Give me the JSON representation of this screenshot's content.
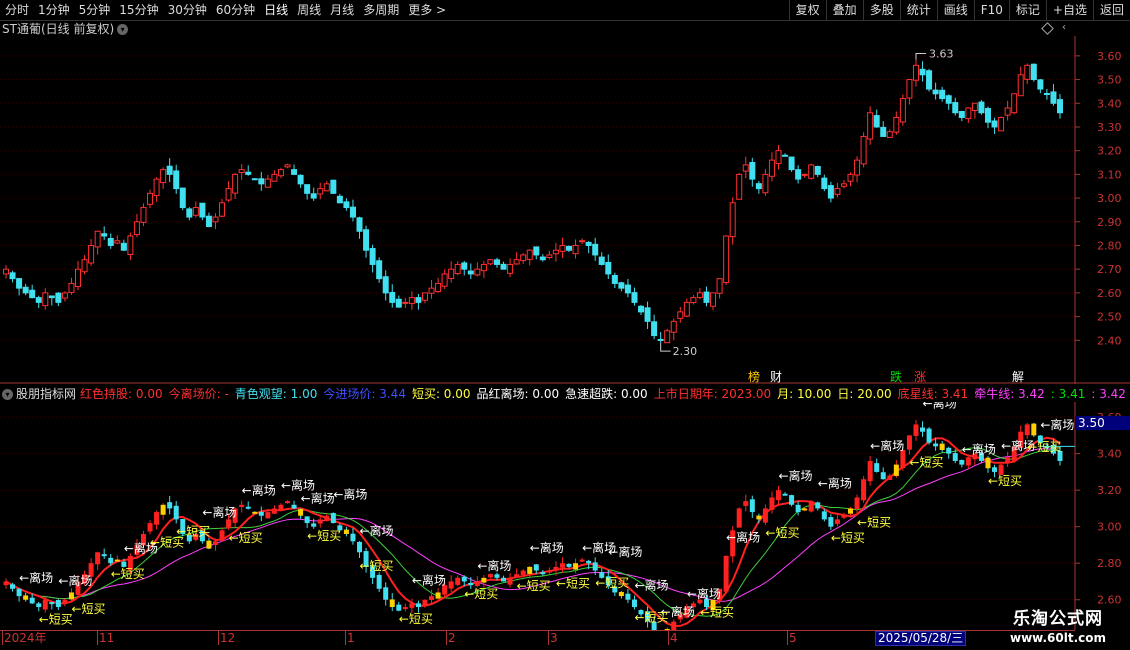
{
  "toolbar": {
    "left": [
      "分时",
      "1分钟",
      "5分钟",
      "15分钟",
      "30分钟",
      "60分钟",
      "日线",
      "周线",
      "月线",
      "多周期",
      "更多 >"
    ],
    "right": [
      "复权",
      "叠加",
      "多股",
      "统计",
      "画线",
      "F10",
      "标记",
      "+自选",
      "返回"
    ]
  },
  "main_panel": {
    "title": "ST通葡(日线 前复权)",
    "y_ticks": [
      "3.60",
      "3.50",
      "3.40",
      "3.30",
      "3.20",
      "3.10",
      "3.00",
      "2.90",
      "2.80",
      "2.70",
      "2.60",
      "2.50",
      "2.40"
    ],
    "high_label": "3.63",
    "low_label": "2.30",
    "event_tags": [
      {
        "text": "榜",
        "color": "#ffcc00"
      },
      {
        "text": "财",
        "color": "#ffffff"
      },
      {
        "text": "跌",
        "color": "#00e000"
      },
      {
        "text": "涨",
        "color": "#ff3030"
      },
      {
        "text": "解",
        "color": "#ffffff"
      }
    ]
  },
  "sub_panel": {
    "name": "股朋指标网",
    "fields": [
      {
        "text": "红色持股: 0.00",
        "color": "#ff3030"
      },
      {
        "text": "今离场价: -",
        "color": "#ff3030"
      },
      {
        "text": "青色观望: 1.00",
        "color": "#40e0f0"
      },
      {
        "text": "今进场价: 3.44",
        "color": "#4050ff"
      },
      {
        "text": "短买: 0.00",
        "color": "#ffff40"
      },
      {
        "text": "品红离场: 0.00",
        "color": "#ffffff"
      },
      {
        "text": "急速超跌: 0.00",
        "color": "#ffffff"
      },
      {
        "text": "上市日期年: 2023.00",
        "color": "#ff3030"
      },
      {
        "text": "月: 10.00",
        "color": "#ffff40"
      },
      {
        "text": "日: 20.00",
        "color": "#ffff40"
      },
      {
        "text": "底星线: 3.41",
        "color": "#ff3030"
      },
      {
        "text": "牵牛线: 3.42",
        "color": "#ff40ff"
      },
      {
        "text": ": 3.41",
        "color": "#00e000"
      },
      {
        "text": ": 3.42",
        "color": "#ff40ff"
      }
    ],
    "y_ticks": [
      "3.60",
      "3.40",
      "3.20",
      "3.00",
      "2.80",
      "2.60"
    ],
    "current_price": "3.50",
    "signal_exit": "←离场",
    "signal_buy": "←短买"
  },
  "x_axis": {
    "labels": [
      "2024年",
      "11",
      "12",
      "1",
      "2",
      "3",
      "4",
      "5"
    ],
    "current_date": "2025/05/28/三"
  },
  "watermark": {
    "line1": "乐淘公式网",
    "line2": "www.60lt.com"
  },
  "chart_data": {
    "type": "candlestick",
    "title": "ST通葡(日线 前复权)",
    "ylim": [
      2.3,
      3.65
    ],
    "period_labels": [
      "2024年",
      "11",
      "12",
      "1",
      "2",
      "3",
      "4",
      "5"
    ],
    "close": [
      2.7,
      2.66,
      2.62,
      2.6,
      2.58,
      2.56,
      2.6,
      2.58,
      2.56,
      2.6,
      2.64,
      2.7,
      2.74,
      2.8,
      2.86,
      2.84,
      2.8,
      2.82,
      2.78,
      2.84,
      2.9,
      2.96,
      3.02,
      3.08,
      3.12,
      3.1,
      3.04,
      2.96,
      2.92,
      2.96,
      2.92,
      2.88,
      2.92,
      2.98,
      3.04,
      3.1,
      3.12,
      3.1,
      3.08,
      3.06,
      3.08,
      3.1,
      3.12,
      3.14,
      3.1,
      3.06,
      3.02,
      3.0,
      3.04,
      3.06,
      3.02,
      2.98,
      2.96,
      2.92,
      2.86,
      2.78,
      2.72,
      2.66,
      2.6,
      2.56,
      2.54,
      2.56,
      2.58,
      2.56,
      2.6,
      2.62,
      2.64,
      2.68,
      2.7,
      2.72,
      2.7,
      2.68,
      2.7,
      2.72,
      2.74,
      2.72,
      2.7,
      2.72,
      2.74,
      2.76,
      2.78,
      2.76,
      2.74,
      2.76,
      2.78,
      2.8,
      2.78,
      2.8,
      2.82,
      2.8,
      2.76,
      2.72,
      2.68,
      2.64,
      2.62,
      2.6,
      2.56,
      2.52,
      2.48,
      2.42,
      2.4,
      2.44,
      2.48,
      2.52,
      2.56,
      2.58,
      2.6,
      2.56,
      2.6,
      2.66,
      2.84,
      2.98,
      3.1,
      3.14,
      3.08,
      3.04,
      3.1,
      3.16,
      3.2,
      3.18,
      3.12,
      3.08,
      3.1,
      3.14,
      3.1,
      3.04,
      3.0,
      3.04,
      3.06,
      3.1,
      3.16,
      3.26,
      3.36,
      3.3,
      3.26,
      3.28,
      3.34,
      3.42,
      3.5,
      3.56,
      3.52,
      3.46,
      3.44,
      3.42,
      3.4,
      3.36,
      3.34,
      3.38,
      3.4,
      3.36,
      3.32,
      3.3,
      3.34,
      3.38,
      3.44,
      3.52,
      3.56,
      3.5,
      3.46,
      3.44,
      3.4,
      3.36
    ]
  }
}
